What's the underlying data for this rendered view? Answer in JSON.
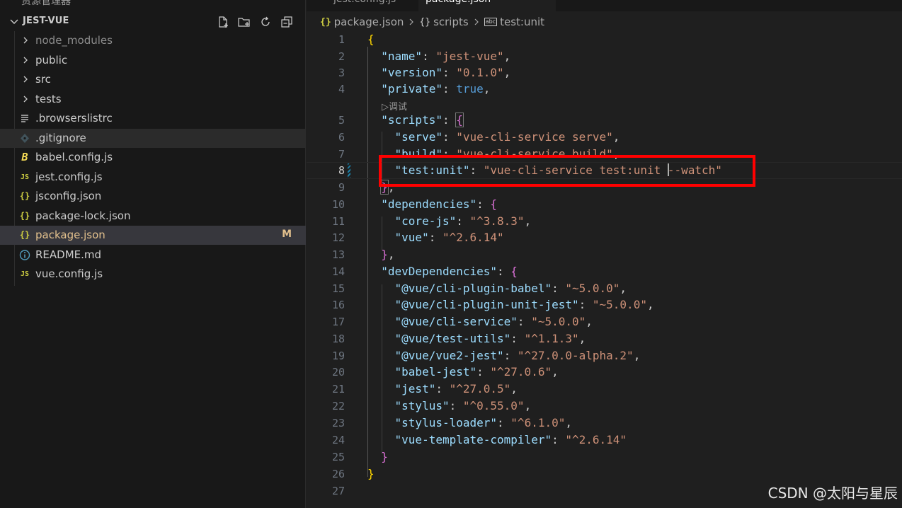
{
  "tabs": {
    "tab1": "jest.config.js",
    "tab2": "package.json"
  },
  "explorer": {
    "top_strip": "资源管理器",
    "project_title": "JEST-VUE",
    "actions": [
      "new-file-icon",
      "new-folder-icon",
      "refresh-icon",
      "collapse-all-icon"
    ],
    "items": [
      {
        "label": "node_modules",
        "type": "folder",
        "color": "#8c8c8c"
      },
      {
        "label": "public",
        "type": "folder",
        "color": "#cccccc"
      },
      {
        "label": "src",
        "type": "folder",
        "color": "#cccccc"
      },
      {
        "label": "tests",
        "type": "folder",
        "color": "#cccccc"
      },
      {
        "label": ".browserslistrc",
        "type": "file",
        "icon": "lines-icon",
        "color": "#cccccc"
      },
      {
        "label": ".gitignore",
        "type": "file",
        "icon": "git-icon",
        "color": "#cccccc"
      },
      {
        "label": "babel.config.js",
        "type": "file",
        "icon": "babel-icon",
        "color": "#cccccc"
      },
      {
        "label": "jest.config.js",
        "type": "file",
        "icon": "js-icon",
        "color": "#cccccc"
      },
      {
        "label": "jsconfig.json",
        "type": "file",
        "icon": "json-icon",
        "color": "#cccccc"
      },
      {
        "label": "package-lock.json",
        "type": "file",
        "icon": "json-icon",
        "color": "#cccccc"
      },
      {
        "label": "package.json",
        "type": "file",
        "icon": "json-icon",
        "color": "#e2c08d",
        "badge": "M"
      },
      {
        "label": "README.md",
        "type": "file",
        "icon": "info-icon",
        "color": "#cccccc"
      },
      {
        "label": "vue.config.js",
        "type": "file",
        "icon": "js-icon",
        "color": "#cccccc"
      }
    ]
  },
  "breadcrumb": {
    "file": "package.json",
    "section": "scripts",
    "leaf": "test:unit",
    "file_icon": "{}",
    "section_icon": "{}",
    "leaf_icon": "abc"
  },
  "editor": {
    "codelens": "▷调试",
    "line_numbers": [
      "1",
      "2",
      "3",
      "4",
      "5",
      "6",
      "7",
      "8",
      "9",
      "10",
      "11",
      "12",
      "13",
      "14",
      "15",
      "16",
      "17",
      "18",
      "19",
      "20",
      "21",
      "22",
      "23",
      "24",
      "25",
      "26",
      "27"
    ],
    "lines": {
      "name_key": "\"name\"",
      "name_val": "\"jest-vue\"",
      "version_key": "\"version\"",
      "version_val": "\"0.1.0\"",
      "private_key": "\"private\"",
      "private_val": "true",
      "scripts_key": "\"scripts\"",
      "serve_key": "\"serve\"",
      "serve_val": "\"vue-cli-service serve\"",
      "build_key": "\"build\"",
      "build_val": "\"vue-cli-service build\"",
      "testunit_key": "\"test:unit\"",
      "testunit_val_a": "\"vue-cli-service test:unit ",
      "testunit_val_b": "--watch\"",
      "deps_key": "\"dependencies\"",
      "corejs_key": "\"core-js\"",
      "corejs_val": "\"^3.8.3\"",
      "vue_key": "\"vue\"",
      "vue_val": "\"^2.6.14\"",
      "devdeps_key": "\"devDependencies\"",
      "d1_key": "\"@vue/cli-plugin-babel\"",
      "d1_val": "\"~5.0.0\"",
      "d2_key": "\"@vue/cli-plugin-unit-jest\"",
      "d2_val": "\"~5.0.0\"",
      "d3_key": "\"@vue/cli-service\"",
      "d3_val": "\"~5.0.0\"",
      "d4_key": "\"@vue/test-utils\"",
      "d4_val": "\"^1.1.3\"",
      "d5_key": "\"@vue/vue2-jest\"",
      "d5_val": "\"^27.0.0-alpha.2\"",
      "d6_key": "\"babel-jest\"",
      "d6_val": "\"^27.0.6\"",
      "d7_key": "\"jest\"",
      "d7_val": "\"^27.0.5\"",
      "d8_key": "\"stylus\"",
      "d8_val": "\"^0.55.0\"",
      "d9_key": "\"stylus-loader\"",
      "d9_val": "\"^6.1.0\"",
      "d10_key": "\"vue-template-compiler\"",
      "d10_val": "\"^2.6.14\""
    },
    "colors": {
      "key": "#9cdcfe",
      "string": "#ce9178",
      "boolean": "#569cd6",
      "highlight": "#ff0000"
    }
  },
  "watermark": "CSDN @太阳与星辰"
}
